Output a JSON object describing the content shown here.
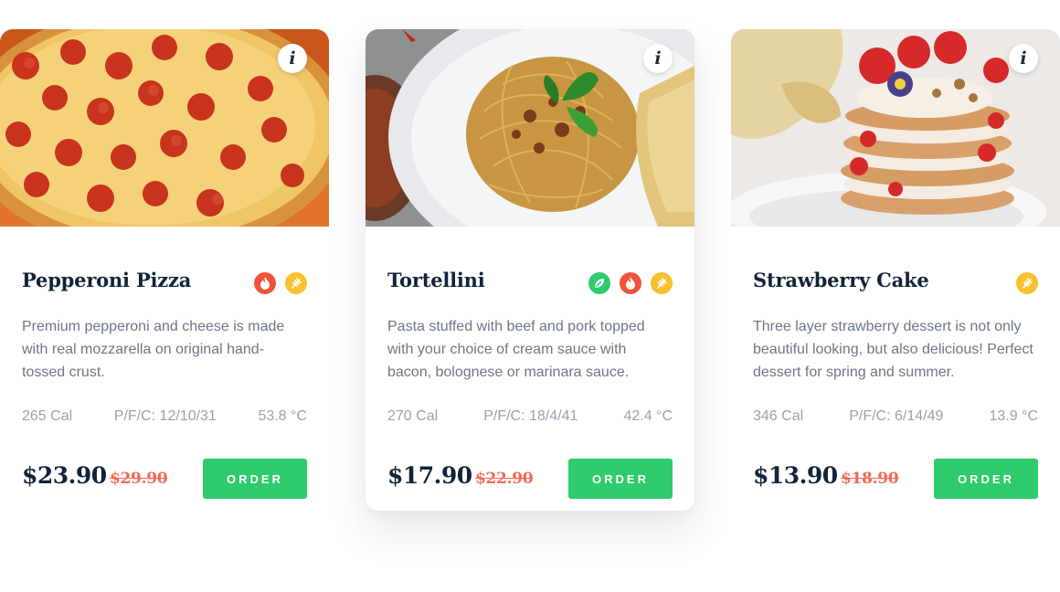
{
  "cards": [
    {
      "title": "Pepperoni Pizza",
      "image": "pepperoni-pizza-photo",
      "badges": [
        "spicy-icon",
        "grain-icon"
      ],
      "description": "Premium pepperoni and cheese is made with real mozzarella on original hand-tossed crust.",
      "calories": "265 Cal",
      "pfc": "P/F/C: 12/10/31",
      "temperature": "53.8 °C",
      "price": "$23.90",
      "old_price": "$29.90",
      "order_label": "ORDER"
    },
    {
      "title": "Tortellini",
      "image": "spaghetti-bolognese-photo",
      "badges": [
        "vegetarian-icon",
        "spicy-icon",
        "grain-icon"
      ],
      "description": "Pasta stuffed with beef and pork topped with your choice of cream sauce with bacon, bolognese or marinara sauce.",
      "calories": "270 Cal",
      "pfc": "P/F/C: 18/4/41",
      "temperature": "42.4 °C",
      "price": "$17.90",
      "old_price": "$22.90",
      "order_label": "ORDER"
    },
    {
      "title": "Strawberry Cake",
      "image": "strawberry-pancake-stack-photo",
      "badges": [
        "grain-icon"
      ],
      "description": "Three layer strawberry dessert is not only beautiful looking, but also delicious! Perfect dessert for spring and summer.",
      "calories": "346 Cal",
      "pfc": "P/F/C: 6/14/49",
      "temperature": "13.9 °C",
      "price": "$13.90",
      "old_price": "$18.90",
      "order_label": "ORDER"
    }
  ],
  "info_label": "i",
  "colors": {
    "order_button": "#2fcb6c",
    "old_price": "#f06a55",
    "badge_spicy": "#f0533a",
    "badge_vegetarian": "#2fcb6c",
    "badge_grain": "#f8c130",
    "title": "#13233a"
  }
}
